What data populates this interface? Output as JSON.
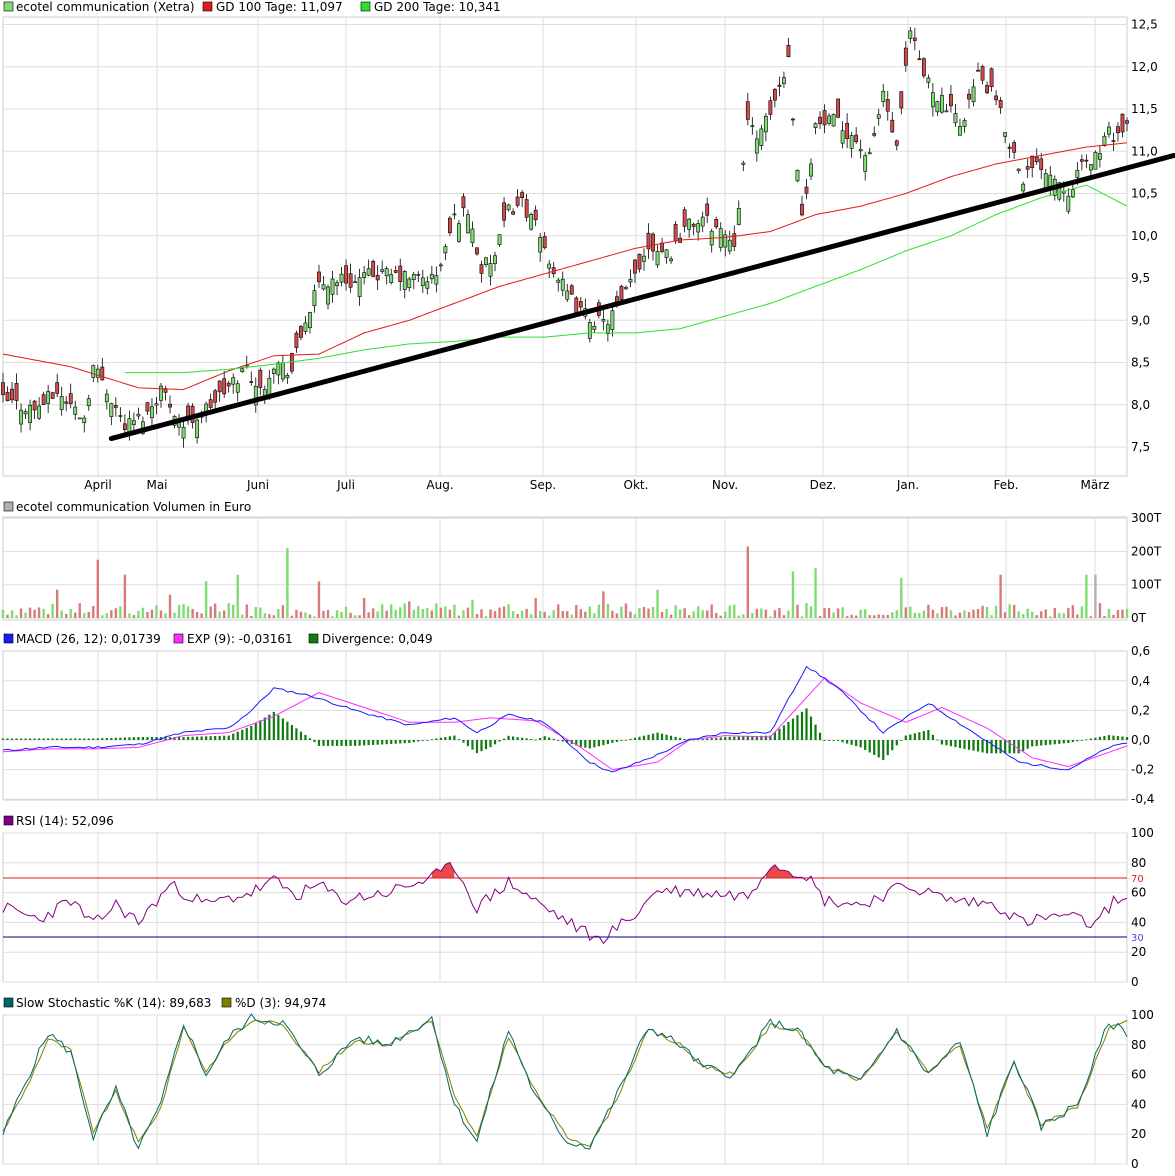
{
  "colors": {
    "up": "#7fdc73",
    "down": "#d44a4a",
    "ma100": "#e31a1c",
    "ma200": "#2ee02e",
    "trend": "#000000",
    "grid": "#dddddd",
    "vol_up": "#7fdc73",
    "vol_down": "#d87a7a",
    "vol_last": "#b0b0b0",
    "macd": "#1a1aff",
    "signal": "#ff2bff",
    "divergence": "#0f7a0f",
    "rsi": "#800080",
    "rsi_fill": "#e84a4a",
    "level70": "#e31a1c",
    "level30": "#00008b",
    "stoch_k": "#006666",
    "stoch_d": "#808000"
  },
  "chart_data": [
    {
      "type": "candlestick",
      "legend": [
        {
          "label": "ecotel communication (Xetra)",
          "color": "#7fdc73"
        },
        {
          "label": "GD 100 Tage: 11,097",
          "color": "#e31a1c"
        },
        {
          "label": "GD 200 Tage: 10,341",
          "color": "#2ee02e"
        }
      ],
      "x_ticks": [
        "April",
        "Mai",
        "Juni",
        "Juli",
        "Aug.",
        "Sep.",
        "Okt.",
        "Nov.",
        "Dez.",
        "Jan.",
        "Feb.",
        "März"
      ],
      "y_ticks": [
        "7,5",
        "8,0",
        "8,5",
        "9,0",
        "9,5",
        "10,0",
        "10,5",
        "11,0",
        "11,5",
        "12,0",
        "12,5"
      ],
      "ylim": [
        7.2,
        12.85
      ],
      "close_path": [
        [
          0,
          8.05
        ],
        [
          7,
          7.95
        ],
        [
          12,
          8.15
        ],
        [
          18,
          7.85
        ],
        [
          20,
          8.45
        ],
        [
          22,
          8.3
        ],
        [
          27,
          7.75
        ],
        [
          32,
          7.9
        ],
        [
          35,
          8.2
        ],
        [
          40,
          7.75
        ],
        [
          45,
          7.95
        ],
        [
          50,
          8.2
        ],
        [
          54,
          8.45
        ],
        [
          57,
          8.15
        ],
        [
          60,
          8.5
        ],
        [
          64,
          8.4
        ],
        [
          67,
          9.0
        ],
        [
          70,
          9.4
        ],
        [
          74,
          9.5
        ],
        [
          78,
          9.45
        ],
        [
          82,
          9.55
        ],
        [
          90,
          9.5
        ],
        [
          96,
          9.5
        ],
        [
          100,
          10.2
        ],
        [
          103,
          10.3
        ],
        [
          106,
          9.6
        ],
        [
          109,
          9.75
        ],
        [
          112,
          10.3
        ],
        [
          115,
          10.4
        ],
        [
          118,
          10.1
        ],
        [
          122,
          9.6
        ],
        [
          125,
          9.3
        ],
        [
          128,
          9.1
        ],
        [
          133,
          8.95
        ],
        [
          137,
          9.2
        ],
        [
          140,
          9.55
        ],
        [
          143,
          9.9
        ],
        [
          148,
          9.8
        ],
        [
          151,
          10.1
        ],
        [
          155,
          10.2
        ],
        [
          158,
          10.1
        ],
        [
          162,
          9.95
        ],
        [
          165,
          11.3
        ],
        [
          168,
          11.2
        ],
        [
          171,
          11.6
        ],
        [
          174,
          12.1
        ],
        [
          177,
          10.2
        ],
        [
          180,
          11.3
        ],
        [
          184,
          11.35
        ],
        [
          188,
          11.2
        ],
        [
          192,
          10.9
        ],
        [
          195,
          11.7
        ],
        [
          198,
          11.0
        ],
        [
          201,
          12.4
        ],
        [
          204,
          11.9
        ],
        [
          208,
          11.6
        ],
        [
          212,
          11.3
        ],
        [
          216,
          11.9
        ],
        [
          220,
          11.6
        ],
        [
          223,
          11.1
        ],
        [
          226,
          10.7
        ],
        [
          230,
          10.85
        ],
        [
          233,
          10.7
        ],
        [
          236,
          10.55
        ],
        [
          239,
          10.8
        ],
        [
          242,
          10.95
        ],
        [
          245,
          11.2
        ],
        [
          249,
          11.25
        ]
      ],
      "ma100": [
        [
          0,
          8.6
        ],
        [
          15,
          8.45
        ],
        [
          30,
          8.2
        ],
        [
          40,
          8.18
        ],
        [
          50,
          8.4
        ],
        [
          60,
          8.58
        ],
        [
          70,
          8.6
        ],
        [
          80,
          8.85
        ],
        [
          90,
          9.0
        ],
        [
          100,
          9.2
        ],
        [
          110,
          9.4
        ],
        [
          120,
          9.55
        ],
        [
          130,
          9.7
        ],
        [
          140,
          9.85
        ],
        [
          150,
          9.95
        ],
        [
          160,
          9.98
        ],
        [
          170,
          10.05
        ],
        [
          180,
          10.25
        ],
        [
          190,
          10.35
        ],
        [
          200,
          10.5
        ],
        [
          210,
          10.7
        ],
        [
          220,
          10.85
        ],
        [
          230,
          10.95
        ],
        [
          240,
          11.05
        ],
        [
          249,
          11.1
        ]
      ],
      "ma200": [
        [
          27,
          8.38
        ],
        [
          40,
          8.38
        ],
        [
          50,
          8.42
        ],
        [
          60,
          8.48
        ],
        [
          70,
          8.55
        ],
        [
          80,
          8.65
        ],
        [
          90,
          8.72
        ],
        [
          100,
          8.75
        ],
        [
          110,
          8.8
        ],
        [
          120,
          8.8
        ],
        [
          130,
          8.85
        ],
        [
          140,
          8.85
        ],
        [
          150,
          8.9
        ],
        [
          160,
          9.05
        ],
        [
          170,
          9.2
        ],
        [
          180,
          9.4
        ],
        [
          190,
          9.6
        ],
        [
          200,
          9.82
        ],
        [
          210,
          10.0
        ],
        [
          220,
          10.25
        ],
        [
          230,
          10.45
        ],
        [
          240,
          10.6
        ],
        [
          249,
          10.35
        ]
      ],
      "trendline": [
        [
          24,
          7.6
        ],
        [
          260,
          10.95
        ]
      ]
    },
    {
      "type": "bar",
      "legend": [
        {
          "label": "ecotel communication Volumen in Euro",
          "color": "#b0b0b0"
        }
      ],
      "y_ticks": [
        "0T",
        "100T",
        "200T",
        "300T"
      ],
      "ylim": [
        0,
        300
      ],
      "x_ticks": [
        "April",
        "Mai",
        "Juni",
        "Juli",
        "Aug.",
        "Sep.",
        "Okt.",
        "Nov.",
        "Dez.",
        "Jan.",
        "Feb.",
        "März"
      ],
      "peaks": [
        [
          12,
          85
        ],
        [
          21,
          175
        ],
        [
          27,
          130
        ],
        [
          37,
          70
        ],
        [
          45,
          110
        ],
        [
          52,
          130
        ],
        [
          63,
          210
        ],
        [
          70,
          110
        ],
        [
          80,
          60
        ],
        [
          90,
          50
        ],
        [
          104,
          55
        ],
        [
          118,
          60
        ],
        [
          133,
          80
        ],
        [
          145,
          85
        ],
        [
          162,
          40
        ],
        [
          165,
          215
        ],
        [
          175,
          140
        ],
        [
          180,
          150
        ],
        [
          199,
          120
        ],
        [
          221,
          130
        ],
        [
          240,
          130
        ]
      ]
    },
    {
      "type": "line",
      "legend": [
        {
          "label": "MACD (26, 12): 0,01739",
          "color": "#1a1aff"
        },
        {
          "label": "EXP (9): -0,03161",
          "color": "#ff2bff"
        },
        {
          "label": "Divergence: 0,049",
          "color": "#0f7a0f"
        }
      ],
      "y_ticks": [
        "-0,4",
        "-0,2",
        "0,0",
        "0,2",
        "0,4",
        "0,6"
      ],
      "ylim": [
        -0.4,
        0.6
      ],
      "macd": [
        [
          0,
          -0.07
        ],
        [
          10,
          -0.05
        ],
        [
          20,
          -0.05
        ],
        [
          30,
          -0.03
        ],
        [
          40,
          0.05
        ],
        [
          50,
          0.08
        ],
        [
          55,
          0.2
        ],
        [
          60,
          0.35
        ],
        [
          68,
          0.3
        ],
        [
          78,
          0.2
        ],
        [
          90,
          0.1
        ],
        [
          100,
          0.15
        ],
        [
          105,
          0.05
        ],
        [
          112,
          0.17
        ],
        [
          120,
          0.12
        ],
        [
          130,
          -0.15
        ],
        [
          135,
          -0.22
        ],
        [
          145,
          -0.1
        ],
        [
          152,
          0.0
        ],
        [
          160,
          0.05
        ],
        [
          170,
          0.05
        ],
        [
          178,
          0.5
        ],
        [
          185,
          0.35
        ],
        [
          195,
          0.05
        ],
        [
          205,
          0.25
        ],
        [
          215,
          0.05
        ],
        [
          225,
          -0.15
        ],
        [
          236,
          -0.2
        ],
        [
          245,
          -0.05
        ],
        [
          249,
          -0.02
        ]
      ],
      "signal": [
        [
          0,
          -0.08
        ],
        [
          10,
          -0.06
        ],
        [
          20,
          -0.06
        ],
        [
          30,
          -0.05
        ],
        [
          40,
          0.03
        ],
        [
          50,
          0.05
        ],
        [
          60,
          0.16
        ],
        [
          70,
          0.32
        ],
        [
          80,
          0.22
        ],
        [
          90,
          0.12
        ],
        [
          100,
          0.12
        ],
        [
          108,
          0.15
        ],
        [
          118,
          0.13
        ],
        [
          128,
          -0.05
        ],
        [
          135,
          -0.2
        ],
        [
          145,
          -0.15
        ],
        [
          152,
          0.0
        ],
        [
          160,
          0.03
        ],
        [
          170,
          0.02
        ],
        [
          182,
          0.42
        ],
        [
          190,
          0.25
        ],
        [
          200,
          0.12
        ],
        [
          208,
          0.22
        ],
        [
          218,
          0.08
        ],
        [
          228,
          -0.12
        ],
        [
          236,
          -0.18
        ],
        [
          249,
          -0.04
        ]
      ],
      "divergence_note": "histogram of MACD minus EXP"
    },
    {
      "type": "line",
      "legend": [
        {
          "label": "RSI (14): 52,096",
          "color": "#800080"
        }
      ],
      "y_ticks": [
        "0",
        "20",
        "40",
        "60",
        "80",
        "100"
      ],
      "ylim": [
        0,
        100
      ],
      "levels": {
        "upper": "70",
        "lower": "30"
      },
      "rsi": [
        [
          0,
          50
        ],
        [
          8,
          42
        ],
        [
          15,
          55
        ],
        [
          20,
          38
        ],
        [
          25,
          52
        ],
        [
          30,
          40
        ],
        [
          37,
          65
        ],
        [
          45,
          52
        ],
        [
          55,
          60
        ],
        [
          60,
          68
        ],
        [
          65,
          58
        ],
        [
          70,
          65
        ],
        [
          75,
          55
        ],
        [
          85,
          60
        ],
        [
          95,
          70
        ],
        [
          100,
          78
        ],
        [
          105,
          50
        ],
        [
          112,
          67
        ],
        [
          120,
          50
        ],
        [
          128,
          35
        ],
        [
          132,
          28
        ],
        [
          140,
          45
        ],
        [
          145,
          62
        ],
        [
          155,
          60
        ],
        [
          165,
          58
        ],
        [
          170,
          80
        ],
        [
          178,
          72
        ],
        [
          182,
          55
        ],
        [
          190,
          52
        ],
        [
          200,
          65
        ],
        [
          210,
          55
        ],
        [
          220,
          52
        ],
        [
          226,
          40
        ],
        [
          235,
          45
        ],
        [
          242,
          38
        ],
        [
          246,
          55
        ],
        [
          249,
          52
        ]
      ]
    },
    {
      "type": "line",
      "legend": [
        {
          "label": "Slow Stochastic %K (14): 89,683",
          "color": "#006666"
        },
        {
          "label": "%D (3): 94,974",
          "color": "#808000"
        }
      ],
      "y_ticks": [
        "0",
        "20",
        "40",
        "60",
        "80",
        "100"
      ],
      "ylim": [
        0,
        100
      ],
      "k": [
        [
          0,
          20
        ],
        [
          5,
          55
        ],
        [
          10,
          88
        ],
        [
          15,
          75
        ],
        [
          20,
          18
        ],
        [
          25,
          50
        ],
        [
          30,
          10
        ],
        [
          35,
          40
        ],
        [
          40,
          95
        ],
        [
          45,
          60
        ],
        [
          50,
          85
        ],
        [
          55,
          98
        ],
        [
          62,
          95
        ],
        [
          70,
          60
        ],
        [
          78,
          85
        ],
        [
          85,
          80
        ],
        [
          95,
          98
        ],
        [
          100,
          40
        ],
        [
          105,
          15
        ],
        [
          112,
          90
        ],
        [
          118,
          45
        ],
        [
          125,
          15
        ],
        [
          130,
          12
        ],
        [
          135,
          40
        ],
        [
          143,
          92
        ],
        [
          150,
          80
        ],
        [
          155,
          65
        ],
        [
          162,
          60
        ],
        [
          170,
          95
        ],
        [
          176,
          90
        ],
        [
          182,
          65
        ],
        [
          190,
          55
        ],
        [
          198,
          90
        ],
        [
          205,
          60
        ],
        [
          212,
          82
        ],
        [
          218,
          20
        ],
        [
          224,
          70
        ],
        [
          230,
          25
        ],
        [
          238,
          40
        ],
        [
          245,
          95
        ],
        [
          249,
          88
        ]
      ],
      "d": [
        [
          0,
          22
        ],
        [
          5,
          50
        ],
        [
          10,
          84
        ],
        [
          15,
          76
        ],
        [
          20,
          22
        ],
        [
          25,
          48
        ],
        [
          30,
          14
        ],
        [
          35,
          38
        ],
        [
          40,
          92
        ],
        [
          45,
          62
        ],
        [
          50,
          83
        ],
        [
          55,
          96
        ],
        [
          62,
          94
        ],
        [
          70,
          62
        ],
        [
          78,
          83
        ],
        [
          85,
          80
        ],
        [
          95,
          96
        ],
        [
          100,
          45
        ],
        [
          105,
          18
        ],
        [
          112,
          86
        ],
        [
          118,
          48
        ],
        [
          125,
          18
        ],
        [
          130,
          13
        ],
        [
          135,
          38
        ],
        [
          143,
          90
        ],
        [
          150,
          80
        ],
        [
          155,
          66
        ],
        [
          162,
          60
        ],
        [
          170,
          93
        ],
        [
          176,
          90
        ],
        [
          182,
          66
        ],
        [
          190,
          56
        ],
        [
          198,
          88
        ],
        [
          205,
          62
        ],
        [
          212,
          80
        ],
        [
          218,
          24
        ],
        [
          224,
          68
        ],
        [
          230,
          27
        ],
        [
          238,
          38
        ],
        [
          245,
          92
        ],
        [
          249,
          95
        ]
      ]
    }
  ]
}
